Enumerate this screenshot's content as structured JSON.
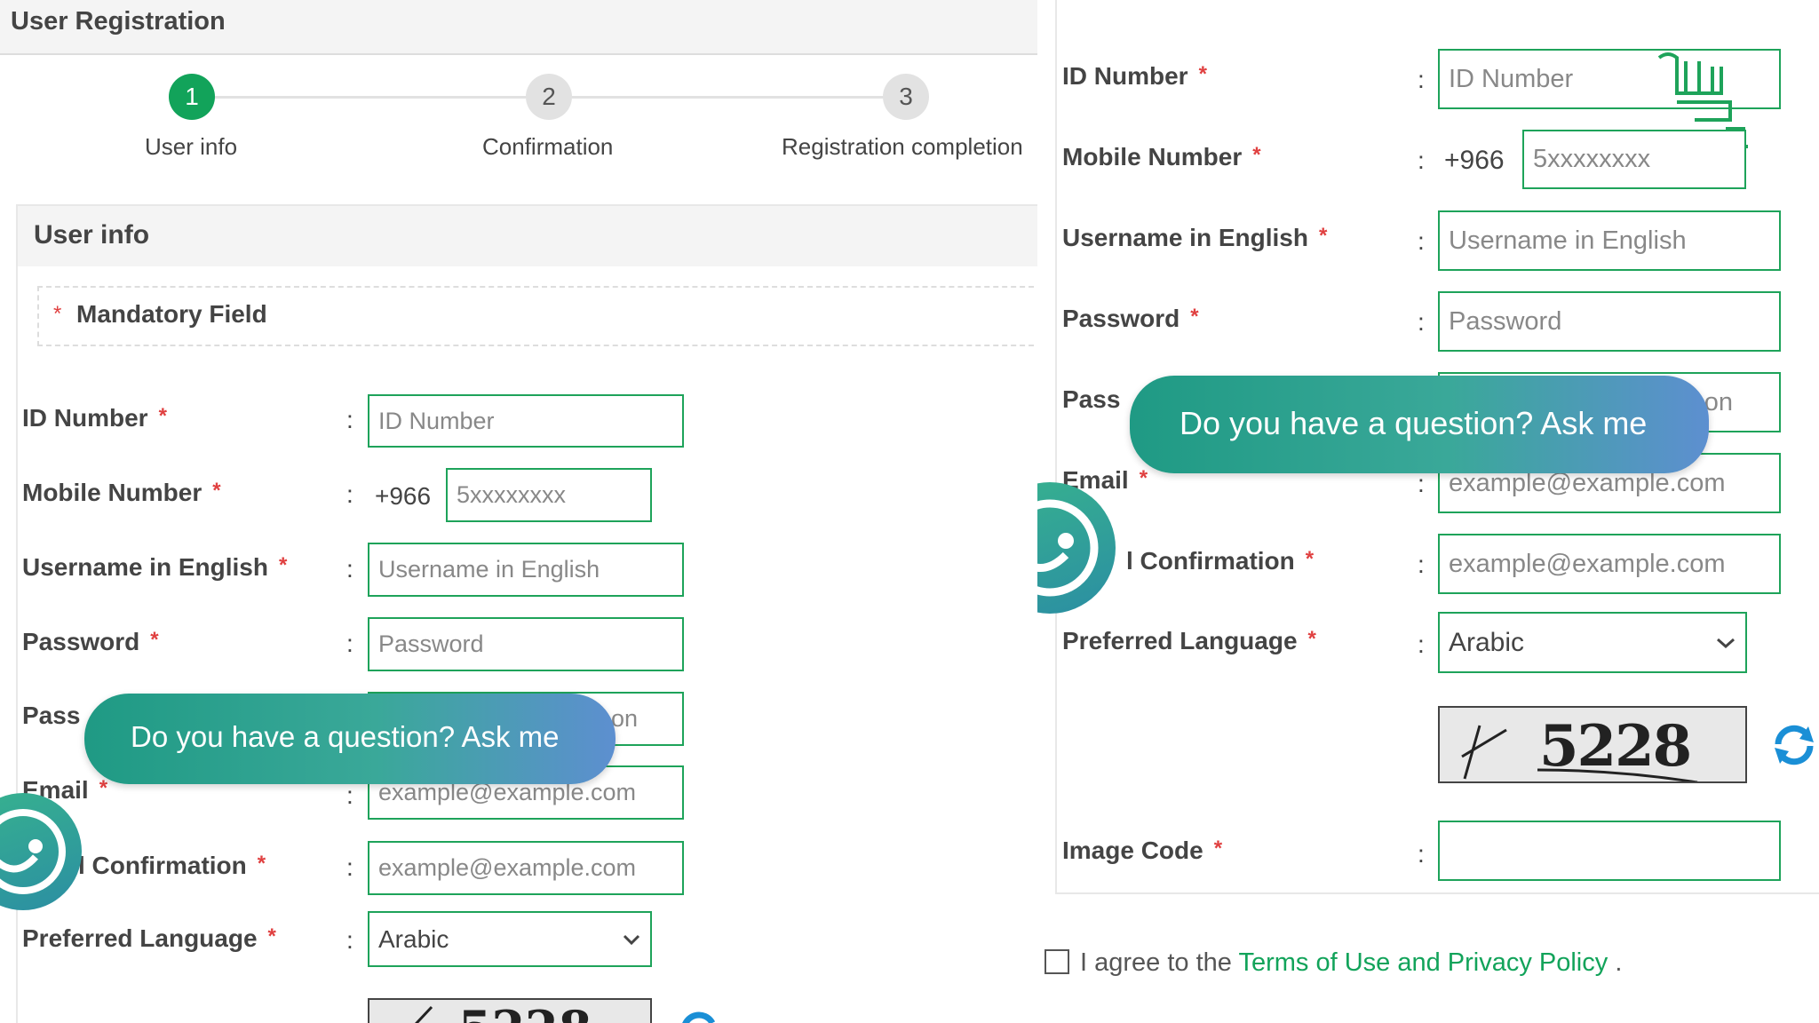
{
  "page": {
    "title": "User Registration"
  },
  "steps": [
    {
      "number": "1",
      "label": "User info",
      "active": true
    },
    {
      "number": "2",
      "label": "Confirmation",
      "active": false
    },
    {
      "number": "3",
      "label": "Registration completion",
      "active": false
    }
  ],
  "section": {
    "title": "User info",
    "mandatory_note": "Mandatory Field",
    "required_mark": "*"
  },
  "form": {
    "colon": ":",
    "id_number": {
      "label": "ID Number",
      "placeholder": "ID Number"
    },
    "mobile": {
      "label": "Mobile Number",
      "prefix": "+966",
      "placeholder": "5xxxxxxxx"
    },
    "username_en": {
      "label": "Username in English",
      "placeholder": "Username in English"
    },
    "password": {
      "label": "Password",
      "placeholder": "Password"
    },
    "password_confirm": {
      "label_visible": "Pass",
      "placeholder_visible": "on"
    },
    "email": {
      "label": "Email",
      "placeholder": "example@example.com"
    },
    "email_confirm": {
      "label_visible": "l Confirmation",
      "placeholder": "example@example.com"
    },
    "language": {
      "label": "Preferred Language",
      "value": "Arabic"
    },
    "captcha": {
      "code": "5228",
      "refresh_icon": "refresh-icon"
    },
    "image_code": {
      "label": "Image Code",
      "value": ""
    }
  },
  "chat": {
    "bubble_text": "Do you have a question? Ask me",
    "avatar_icon": "chatbot-avatar-icon"
  },
  "terms": {
    "prefix": "I agree to the",
    "link": "Terms of Use and Privacy Policy",
    "suffix": ".",
    "checked": false
  },
  "colors": {
    "accent_green": "#12a35a",
    "input_border": "#1ea35a",
    "required_red": "#e04040",
    "refresh_blue": "#1a8fd6"
  }
}
